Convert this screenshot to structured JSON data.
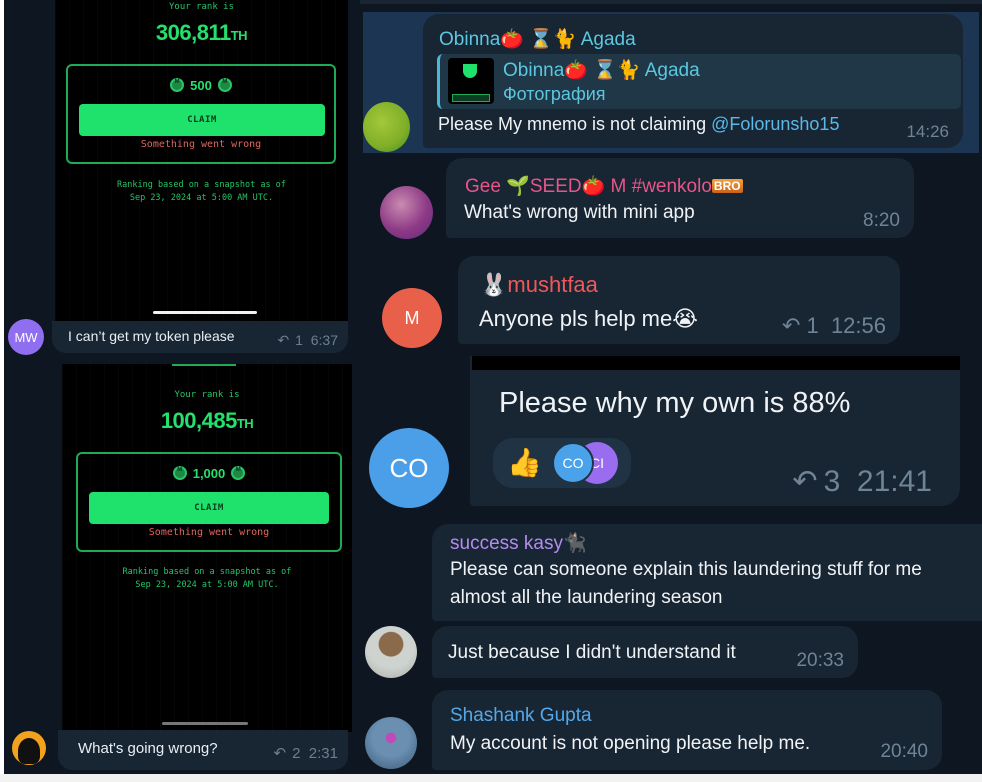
{
  "left": {
    "screenshot1": {
      "rank_label": "Your rank is",
      "rank_value": "306,811",
      "rank_suffix": "TH",
      "reward_amount": "500",
      "claim_label": "CLAIM",
      "error_text": "Something went wrong",
      "snapshot_line1": "Ranking based on a snapshot as of",
      "snapshot_line2": "Sep 23, 2024 at 5:00 AM UTC."
    },
    "message1": {
      "avatar_initials": "MW",
      "avatar_color": "#8f6ff0",
      "text": "I can’t get my token please",
      "replies": "1",
      "time": "6:37"
    },
    "screenshot2": {
      "rank_label": "Your rank is",
      "rank_value": "100,485",
      "rank_suffix": "TH",
      "reward_amount": "1,000",
      "claim_label": "CLAIM",
      "error_text": "Something went wrong",
      "snapshot_line1": "Ranking based on a snapshot as of",
      "snapshot_line2": "Sep 23, 2024 at 5:00 AM UTC."
    },
    "message2": {
      "text": "What's going wrong?",
      "replies": "2",
      "time": "2:31"
    }
  },
  "right": {
    "messages": [
      {
        "sender": "Obinna🍅 ⌛🐈 Agada",
        "sender_color": "#5bc8e0",
        "quote_sender": "Obinna🍅 ⌛🐈 Agada",
        "quote_text": "Фотография",
        "text": "Please My mnemo is not claiming ",
        "mention": "@Folorunsho15",
        "time": "14:26",
        "highlighted": true
      },
      {
        "sender": "Gee 🌱SEED🍅 M #wenkolo",
        "sender_badge": "BRO",
        "sender_color": "#e8558a",
        "text": "What's wrong with mini app",
        "time": "8:20"
      },
      {
        "sender_emoji": "🐰",
        "sender": "mushtfaa",
        "sender_color": "#f0585b",
        "avatar_initials": "M",
        "avatar_color": "#e8604a",
        "text": "Anyone pls help me😭",
        "replies": "1",
        "time": "12:56"
      },
      {
        "avatar_initials": "CO",
        "avatar_color": "#4a9fe8",
        "text": "Please why my own is 88%",
        "reaction_emoji": "👍",
        "reaction_users": [
          "CO",
          "CI"
        ],
        "reaction_user_colors": [
          "#4aa2ea",
          "#9a6cf0"
        ],
        "replies": "3",
        "time": "21:41"
      },
      {
        "sender": "success kasy🐈‍⬛",
        "sender_color": "#b48cf0",
        "text_line1": "Please can someone explain this laundering stuff for me",
        "text_line2": "almost all the laundering season"
      },
      {
        "text": "Just because I didn't understand it",
        "time": "20:33"
      },
      {
        "sender": "Shashank Gupta",
        "sender_color": "#55a8e8",
        "text": "My account is not opening please help me.",
        "time": "20:40"
      }
    ]
  }
}
